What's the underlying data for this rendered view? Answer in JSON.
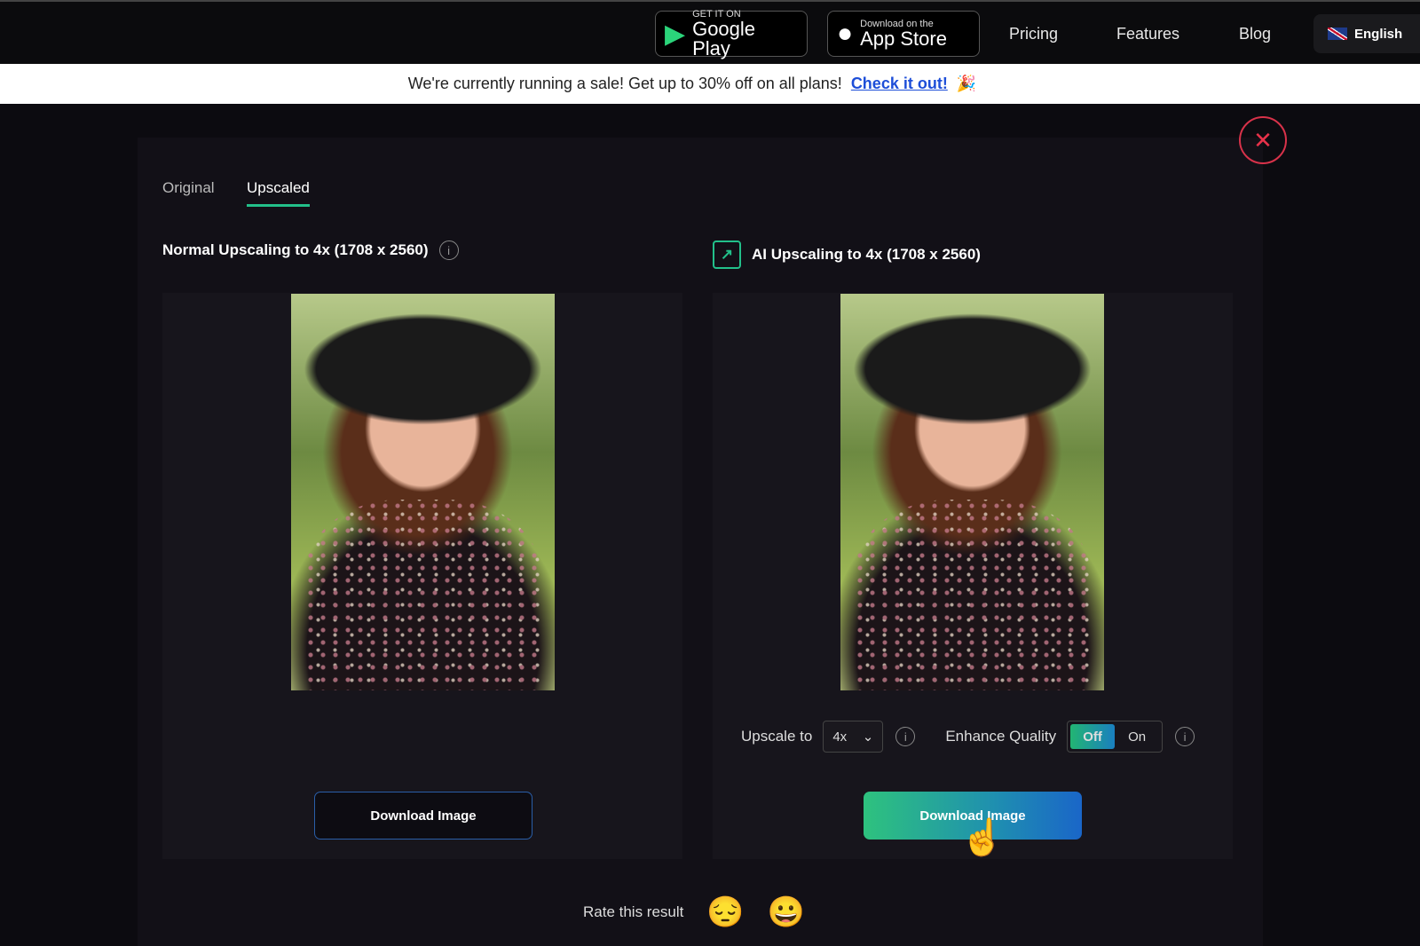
{
  "nav": {
    "google_play": {
      "small": "GET IT ON",
      "big": "Google Play"
    },
    "app_store": {
      "small": "Download on the",
      "big": "App Store"
    },
    "links": [
      "Pricing",
      "Features",
      "Blog"
    ],
    "language": "English"
  },
  "banner": {
    "text": "We're currently running a sale! Get up to 30% off on all plans!",
    "link": "Check it out!",
    "icon": "party-popper-icon"
  },
  "tabs": [
    {
      "label": "Original",
      "active": false
    },
    {
      "label": "Upscaled",
      "active": true
    }
  ],
  "left": {
    "title": "Normal Upscaling to 4x (1708 x 2560)",
    "download": "Download Image"
  },
  "right": {
    "title": "AI Upscaling to 4x (1708 x 2560)",
    "upscale_label": "Upscale to",
    "upscale_value": "4x",
    "enhance_label": "Enhance Quality",
    "toggle_off": "Off",
    "toggle_on": "On",
    "toggle_state": "Off",
    "download": "Download Image"
  },
  "rate": {
    "label": "Rate this result",
    "options": [
      "😔",
      "😀"
    ]
  },
  "colors": {
    "accent": "#22c08a",
    "close": "#d8324a",
    "link": "#1d4ed8"
  }
}
